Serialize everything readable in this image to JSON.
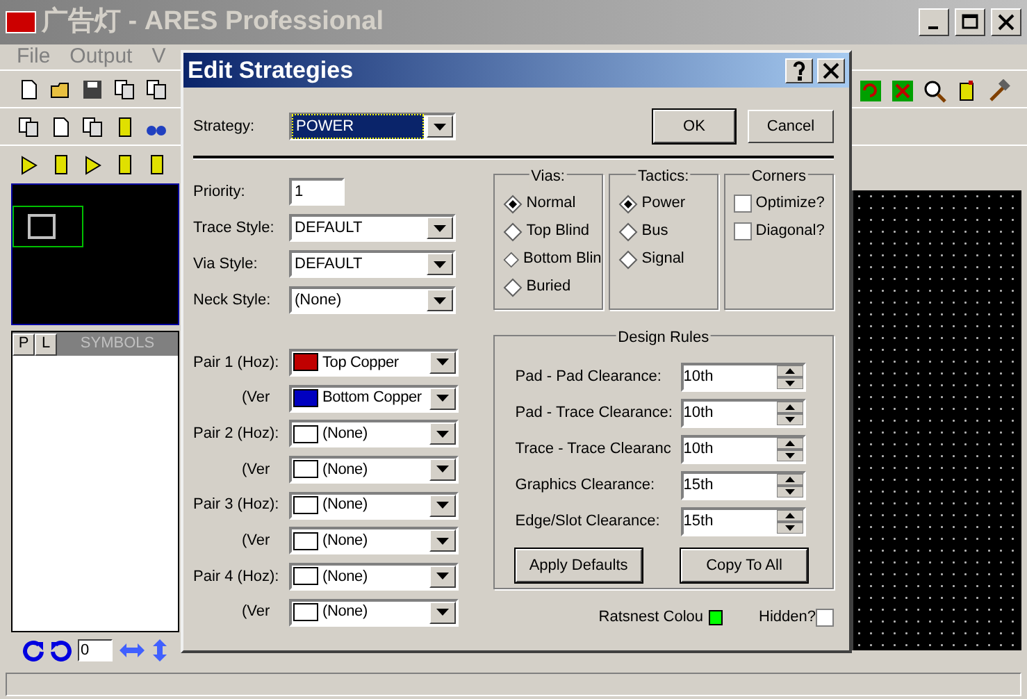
{
  "app": {
    "title": "广告灯 - ARES Professional",
    "menu": [
      "File",
      "Output",
      "V"
    ],
    "panel_tabs": [
      "P",
      "L"
    ],
    "symbols_header": "SYMBOLS",
    "rotation": "0"
  },
  "dialog": {
    "title": "Edit Strategies",
    "strategy_label": "Strategy:",
    "strategy": "POWER",
    "buttons": [
      "OK",
      "Cancel"
    ],
    "fields": [
      {
        "label": "Priority:",
        "kind": "text",
        "value": "1"
      },
      {
        "label": "Trace Style:",
        "kind": "combo",
        "value": "DEFAULT"
      },
      {
        "label": "Via Style:",
        "kind": "combo",
        "value": "DEFAULT"
      },
      {
        "label": "Neck Style:",
        "kind": "combo",
        "value": "(None)"
      }
    ],
    "pairs": [
      {
        "label": "Pair 1 (Hoz):",
        "value": "Top Copper",
        "color": "#c00000"
      },
      {
        "label": "(Ver",
        "value": "Bottom Copper",
        "color": "#0000c0"
      },
      {
        "label": "Pair 2 (Hoz):",
        "value": "(None)",
        "color": "#ffffff"
      },
      {
        "label": "(Ver",
        "value": "(None)",
        "color": "#ffffff"
      },
      {
        "label": "Pair 3 (Hoz):",
        "value": "(None)",
        "color": "#ffffff"
      },
      {
        "label": "(Ver",
        "value": "(None)",
        "color": "#ffffff"
      },
      {
        "label": "Pair 4 (Hoz):",
        "value": "(None)",
        "color": "#ffffff"
      },
      {
        "label": "(Ver",
        "value": "(None)",
        "color": "#ffffff"
      }
    ],
    "vias": {
      "title": "Vias:",
      "options": [
        {
          "label": "Normal",
          "selected": true
        },
        {
          "label": "Top Blind",
          "selected": false
        },
        {
          "label": "Bottom Blin",
          "selected": false
        },
        {
          "label": "Buried",
          "selected": false
        }
      ]
    },
    "tactics": {
      "title": "Tactics:",
      "options": [
        {
          "label": "Power",
          "selected": true
        },
        {
          "label": "Bus",
          "selected": false
        },
        {
          "label": "Signal",
          "selected": false
        }
      ]
    },
    "corners": {
      "title": "Corners",
      "options": [
        {
          "label": "Optimize?",
          "checked": false
        },
        {
          "label": "Diagonal?",
          "checked": false
        }
      ]
    },
    "design_rules": {
      "title": "Design Rules",
      "rows": [
        {
          "label": "Pad - Pad Clearance:",
          "value": "10th"
        },
        {
          "label": "Pad - Trace Clearance:",
          "value": "10th"
        },
        {
          "label": "Trace - Trace Clearanc",
          "value": "10th"
        },
        {
          "label": "Graphics Clearance:",
          "value": "15th"
        },
        {
          "label": "Edge/Slot Clearance:",
          "value": "15th"
        }
      ],
      "buttons": [
        "Apply Defaults",
        "Copy To All"
      ]
    },
    "ratsnest": {
      "label": "Ratsnest Colou",
      "color": "#00ff00"
    },
    "hidden": {
      "label": "Hidden?",
      "checked": false
    }
  }
}
